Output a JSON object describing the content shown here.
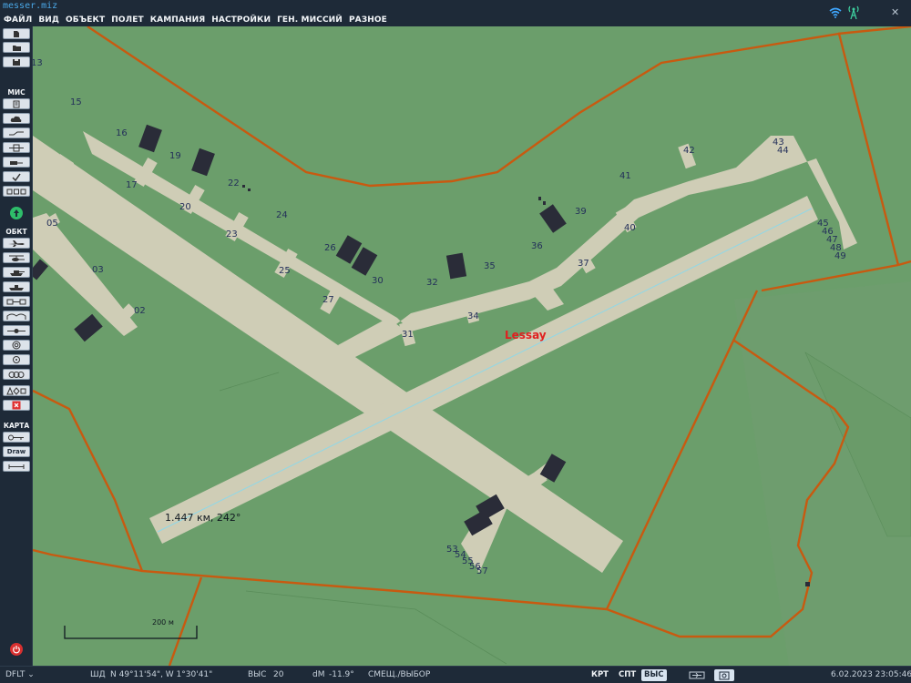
{
  "window": {
    "title": "messer.miz",
    "close": "✕"
  },
  "menu": [
    "ФАЙЛ",
    "ВИД",
    "ОБЪЕКТ",
    "ПОЛЕТ",
    "КАМПАНИЯ",
    "НАСТРОЙКИ",
    "ГЕН. МИССИЙ",
    "РАЗНОЕ"
  ],
  "sidebar": {
    "mission_label": "МИС",
    "objects_label": "ОБКТ",
    "map_label": "КАРТА",
    "draw_label": "Draw"
  },
  "map": {
    "airfield_name": "Lessay",
    "measure_readout": "1.447 км, 242°",
    "scale_label": "200 м",
    "parking_labels": [
      {
        "text": "13"
      },
      {
        "text": "15"
      },
      {
        "text": "16"
      },
      {
        "text": "17"
      },
      {
        "text": "19"
      },
      {
        "text": "20"
      },
      {
        "text": "22"
      },
      {
        "text": "23"
      },
      {
        "text": "24"
      },
      {
        "text": "25"
      },
      {
        "text": "26"
      },
      {
        "text": "27"
      },
      {
        "text": "30"
      },
      {
        "text": "31"
      },
      {
        "text": "32"
      },
      {
        "text": "34"
      },
      {
        "text": "35"
      },
      {
        "text": "36"
      },
      {
        "text": "37"
      },
      {
        "text": "39"
      },
      {
        "text": "40"
      },
      {
        "text": "41"
      },
      {
        "text": "42"
      },
      {
        "text": "43"
      },
      {
        "text": "44"
      },
      {
        "text": "45"
      },
      {
        "text": "46"
      },
      {
        "text": "47"
      },
      {
        "text": "48"
      },
      {
        "text": "49"
      },
      {
        "text": "05"
      },
      {
        "text": "03"
      },
      {
        "text": "02"
      },
      {
        "text": "53"
      },
      {
        "text": "54"
      },
      {
        "text": "55"
      },
      {
        "text": "56"
      },
      {
        "text": "57"
      }
    ],
    "colors": {
      "ground": "#6b9e6b",
      "field_light": "#6e9d6e",
      "pavement": "#cfcdb6",
      "boundary": "#c85a10",
      "hangar": "#2a2c38",
      "runway_line": "#8fd8e8",
      "label": "#24305a",
      "airfield_label": "#e02020"
    }
  },
  "status": {
    "profile": "DFLT",
    "coords_label": "ШД",
    "coords": "N 49°11'54\", W 1°30'41\"",
    "alt_label": "ВЫС",
    "alt_value": "20",
    "dm_label": "dM",
    "dm_value": "-11.9°",
    "mode": "СМЕЩ./ВЫБОР",
    "btn_map": "КРТ",
    "btn_sat": "СПТ",
    "btn_alt": "ВЫС",
    "datetime": "6.02.2023 23:05:46"
  }
}
